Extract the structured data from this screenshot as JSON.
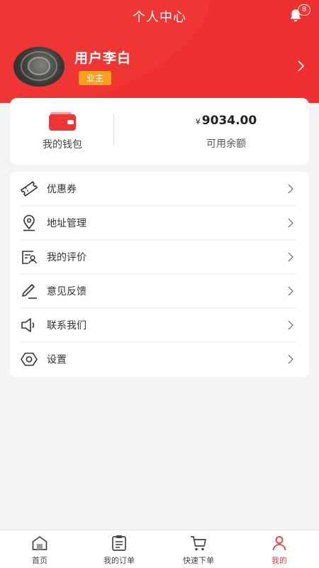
{
  "header": {
    "title": "个人中心",
    "notification_count": "8",
    "bg_color": "#f03535"
  },
  "profile": {
    "username": "用户李白",
    "role_badge": "业主",
    "badge_color": "#f7a21b"
  },
  "wallet": {
    "label": "我的钱包",
    "currency": "¥",
    "balance": "9034.00",
    "balance_label": "可用余额"
  },
  "menu": {
    "items": [
      {
        "label": "优惠券",
        "icon": "coupon-icon"
      },
      {
        "label": "地址管理",
        "icon": "location-pin-icon"
      },
      {
        "label": "我的评价",
        "icon": "review-icon"
      },
      {
        "label": "意见反馈",
        "icon": "pen-icon"
      },
      {
        "label": "联系我们",
        "icon": "speaker-icon"
      },
      {
        "label": "设置",
        "icon": "settings-icon"
      }
    ]
  },
  "bottom_nav": {
    "items": [
      {
        "label": "首页",
        "icon": "home-icon"
      },
      {
        "label": "我的订单",
        "icon": "orders-icon"
      },
      {
        "label": "快速下单",
        "icon": "cart-icon"
      },
      {
        "label": "我的",
        "icon": "user-icon",
        "active": true
      }
    ],
    "active_color": "#e83a3a"
  }
}
